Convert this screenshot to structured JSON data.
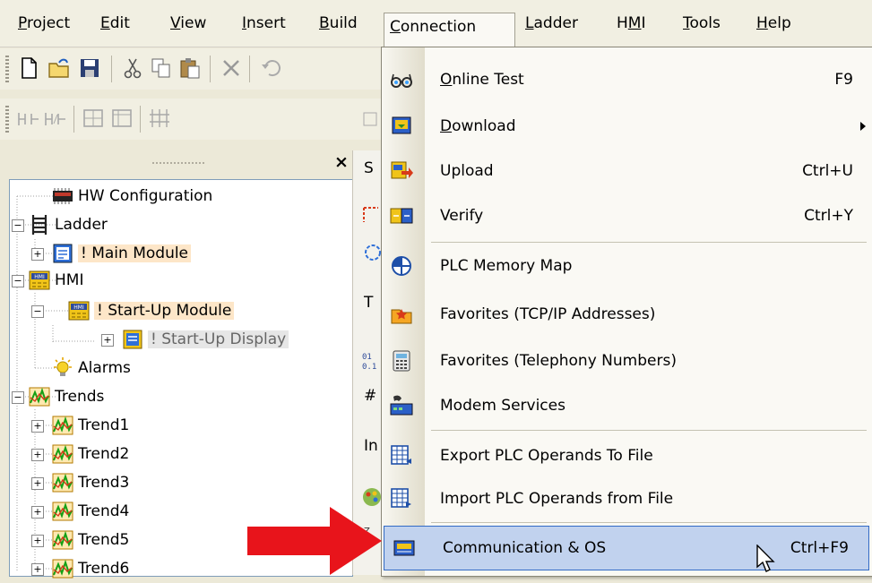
{
  "menubar": {
    "items": [
      {
        "pre": "",
        "u": "P",
        "post": "roject"
      },
      {
        "pre": "",
        "u": "E",
        "post": "dit"
      },
      {
        "pre": "",
        "u": "V",
        "post": "iew"
      },
      {
        "pre": "",
        "u": "I",
        "post": "nsert"
      },
      {
        "pre": "",
        "u": "B",
        "post": "uild"
      },
      {
        "pre": "",
        "u": "C",
        "post": "onnection"
      },
      {
        "pre": "",
        "u": "L",
        "post": "adder"
      },
      {
        "pre": "H",
        "u": "M",
        "post": "I"
      },
      {
        "pre": "",
        "u": "T",
        "post": "ools"
      },
      {
        "pre": "",
        "u": "H",
        "post": "elp"
      }
    ]
  },
  "tree": {
    "hw_config": "HW Configuration",
    "ladder": "Ladder",
    "main_module": "! Main Module",
    "hmi": "HMI",
    "startup_module": "! Start-Up Module",
    "startup_display": "! Start-Up Display",
    "alarms": "Alarms",
    "trends": "Trends",
    "trend1": "Trend1",
    "trend2": "Trend2",
    "trend3": "Trend3",
    "trend4": "Trend4",
    "trend5": "Trend5",
    "trend6": "Trend6"
  },
  "mid": {
    "s": "S",
    "t": "T",
    "hash": "#",
    "in": "In"
  },
  "connection_menu": {
    "online_test": {
      "u": "O",
      "rest": "nline Test",
      "shortcut": "F9"
    },
    "download": {
      "u": "D",
      "rest": "ownload"
    },
    "upload": {
      "label": "Upload",
      "shortcut": "Ctrl+U"
    },
    "verify": {
      "label": "Verify",
      "shortcut": "Ctrl+Y"
    },
    "memory_map": {
      "label": "PLC Memory Map"
    },
    "fav_tcp": {
      "label": "Favorites (TCP/IP Addresses)"
    },
    "fav_tel": {
      "label": "Favorites (Telephony Numbers)"
    },
    "modem": {
      "label": "Modem Services"
    },
    "export": {
      "label": "Export PLC Operands To File"
    },
    "import": {
      "label": "Import PLC Operands from File"
    },
    "comm_os": {
      "label": "Communication & OS",
      "shortcut": "Ctrl+F9"
    }
  },
  "colors": {
    "accent": "#316ac5",
    "hover_bg": "#c1d2ee",
    "arrow": "#e8141b"
  }
}
